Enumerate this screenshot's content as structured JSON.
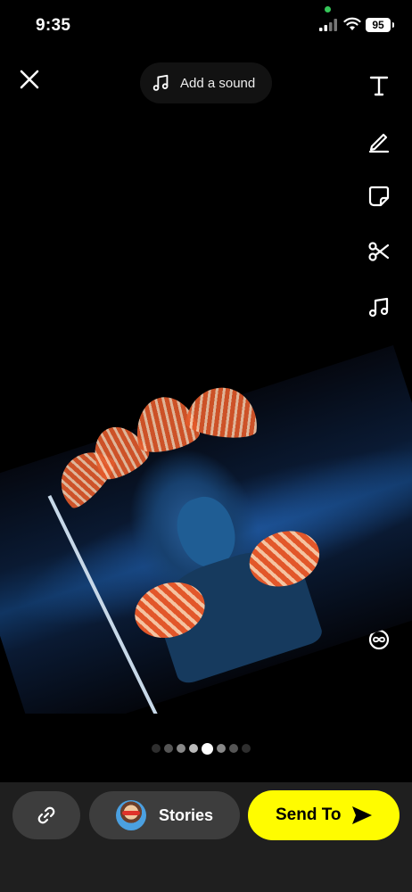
{
  "status_bar": {
    "time": "9:35",
    "battery": "95",
    "privacy_indicator_color": "#35c759"
  },
  "header": {
    "close_icon": "close-icon",
    "add_sound_label": "Add a sound",
    "add_sound_icon": "music-note-icon"
  },
  "toolbar": {
    "items": [
      {
        "name": "text-tool",
        "icon": "text-icon"
      },
      {
        "name": "draw-tool",
        "icon": "pencil-icon"
      },
      {
        "name": "sticker-tool",
        "icon": "sticker-icon"
      },
      {
        "name": "scissors-tool",
        "icon": "scissors-icon"
      },
      {
        "name": "music-tool",
        "icon": "music-note-icon"
      },
      {
        "name": "lens-search-tool",
        "icon": "magnifier-sparkle-icon"
      },
      {
        "name": "magic-wand-tool",
        "icon": "magic-wand-icon"
      },
      {
        "name": "eraser-tool",
        "icon": "eraser-sparkle-icon"
      },
      {
        "name": "attachment-tool",
        "icon": "paperclip-icon"
      },
      {
        "name": "crop-tool",
        "icon": "crop-icon"
      },
      {
        "name": "timer-tool",
        "icon": "infinity-timer-icon"
      }
    ]
  },
  "pager": {
    "count": 8,
    "active_index": 4
  },
  "bottom_bar": {
    "link_icon": "link-icon",
    "stories_label": "Stories",
    "send_label": "Send To",
    "send_icon": "send-arrow-icon",
    "accent_color": "#fffc00"
  }
}
